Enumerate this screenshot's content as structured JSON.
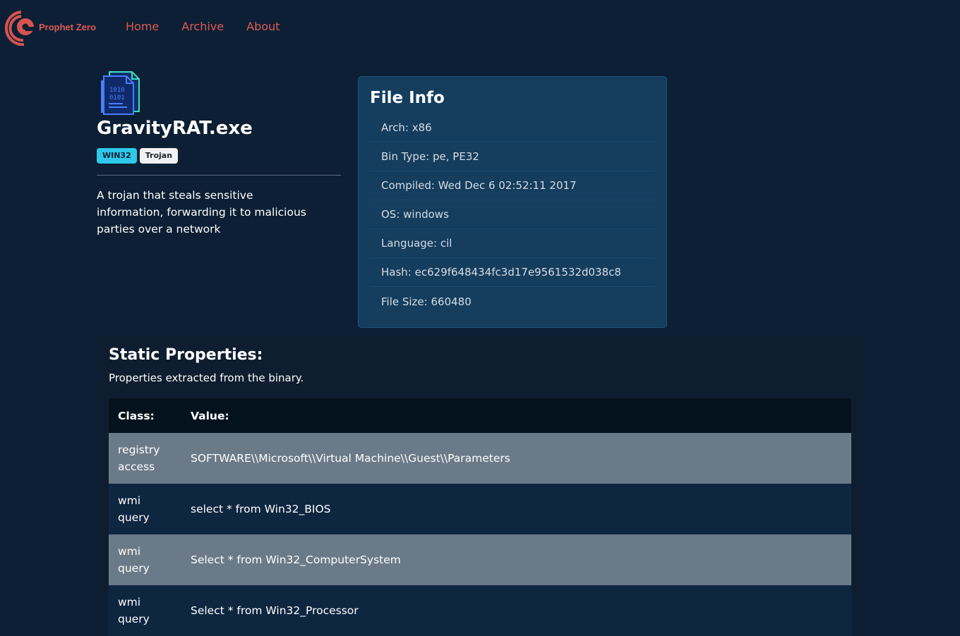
{
  "header": {
    "brand": "Prophet Zero",
    "nav": [
      {
        "label": "Home"
      },
      {
        "label": "Archive"
      },
      {
        "label": "About"
      }
    ]
  },
  "file": {
    "name": "GravityRAT.exe",
    "badges": {
      "platform": "WIN32",
      "type": "Trojan"
    },
    "description": "A trojan that steals sensitive information, forwarding it to malicious parties over a network",
    "icon": "binary-file-icon"
  },
  "file_info": {
    "title": "File Info",
    "items": [
      {
        "key": "Arch: ",
        "value": "x86"
      },
      {
        "key": "Bin Type: ",
        "value": "pe, PE32"
      },
      {
        "key": "Compiled: ",
        "value": "Wed Dec 6 02:52:11 2017"
      },
      {
        "key": "OS: ",
        "value": "windows"
      },
      {
        "key": "Language: ",
        "value": "cil"
      },
      {
        "key": "Hash: ",
        "value": "ec629f648434fc3d17e9561532d038c8"
      },
      {
        "key": "File Size: ",
        "value": "660480"
      }
    ]
  },
  "static_properties": {
    "title": "Static Properties:",
    "subtitle": "Properties extracted from the binary.",
    "columns": {
      "class": "Class:",
      "value": "Value:"
    },
    "rows": [
      {
        "class": "registry access",
        "value": "SOFTWARE\\\\Microsoft\\\\Virtual Machine\\\\Guest\\\\Parameters"
      },
      {
        "class": "wmi query",
        "value": "select * from Win32_BIOS"
      },
      {
        "class": "wmi query",
        "value": "Select * from Win32_ComputerSystem"
      },
      {
        "class": "wmi query",
        "value": "Select * from Win32_Processor"
      }
    ]
  },
  "colors": {
    "background": "#0c1f34",
    "brand": "#e05a55",
    "card": "#143d5e",
    "platform_badge": "#2ec8e8"
  }
}
